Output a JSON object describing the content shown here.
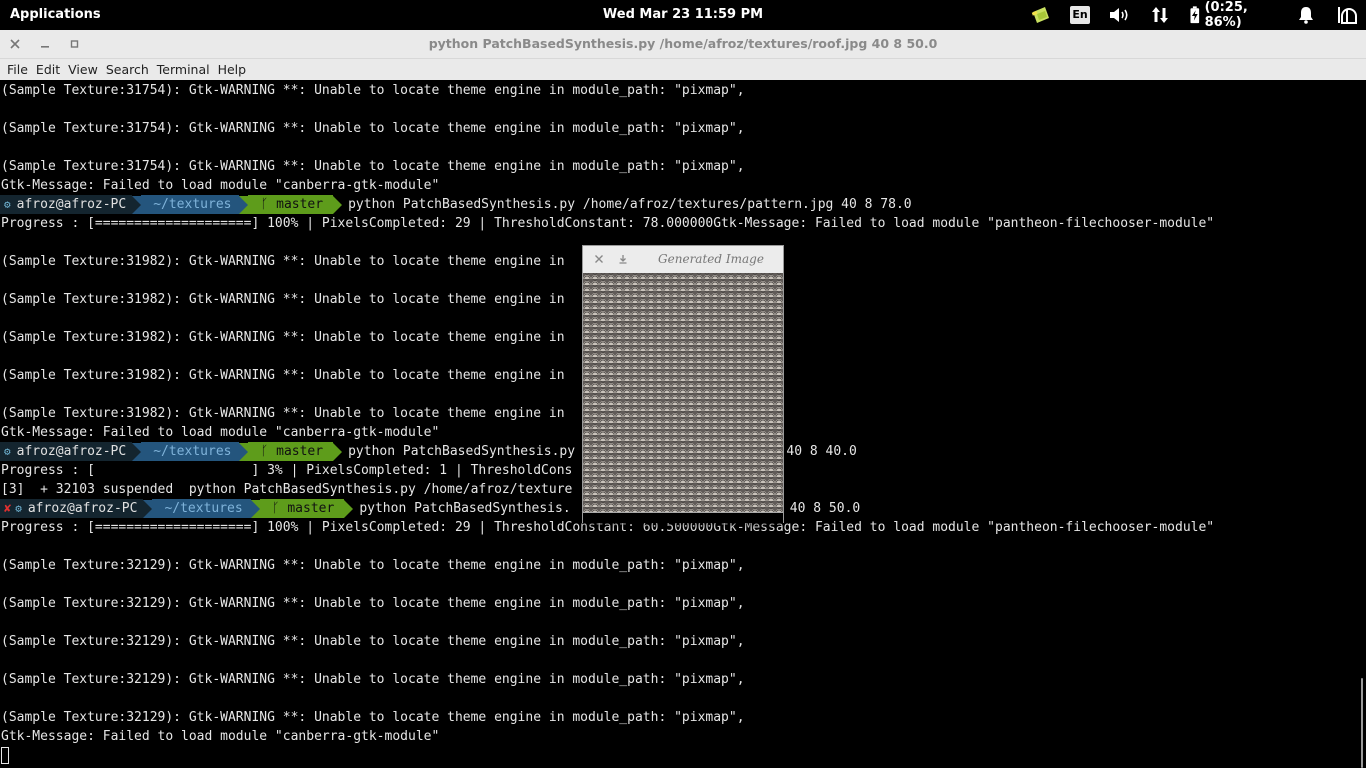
{
  "panel": {
    "applications_label": "Applications",
    "clock": "Wed Mar 23 11:59 PM",
    "lang_label": "En",
    "battery_label": "(0:25, 86%)"
  },
  "window": {
    "title": "python PatchBasedSynthesis.py /home/afroz/textures/roof.jpg 40 8 50.0",
    "menu": [
      "File",
      "Edit",
      "View",
      "Search",
      "Terminal",
      "Help"
    ]
  },
  "terminal": {
    "lines": [
      "(Sample Texture:31754): Gtk-WARNING **: Unable to locate theme engine in module_path: \"pixmap\",",
      "",
      "(Sample Texture:31754): Gtk-WARNING **: Unable to locate theme engine in module_path: \"pixmap\",",
      "",
      "(Sample Texture:31754): Gtk-WARNING **: Unable to locate theme engine in module_path: \"pixmap\",",
      "Gtk-Message: Failed to load module \"canberra-gtk-module\"",
      null,
      "Progress : [====================] 100% | PixelsCompleted: 29 | ThresholdConstant: 78.000000Gtk-Message: Failed to load module \"pantheon-filechooser-module\"",
      "",
      "(Sample Texture:31982): Gtk-WARNING **: Unable to locate theme engine in",
      "",
      "(Sample Texture:31982): Gtk-WARNING **: Unable to locate theme engine in",
      "",
      "(Sample Texture:31982): Gtk-WARNING **: Unable to locate theme engine in",
      "",
      "(Sample Texture:31982): Gtk-WARNING **: Unable to locate theme engine in",
      "",
      "(Sample Texture:31982): Gtk-WARNING **: Unable to locate theme engine in",
      "Gtk-Message: Failed to load module \"canberra-gtk-module\"",
      null,
      "Progress : [                    ] 3% | PixelsCompleted: 1 | ThresholdCons",
      "[3]  + 32103 suspended  python PatchBasedSynthesis.py /home/afroz/texture",
      null,
      "Progress : [====================] 100% | PixelsCompleted: 29 | ThresholdConstant: 60.500000Gtk-Message: Failed to load module \"pantheon-filechooser-module\"",
      "",
      "(Sample Texture:32129): Gtk-WARNING **: Unable to locate theme engine in module_path: \"pixmap\",",
      "",
      "(Sample Texture:32129): Gtk-WARNING **: Unable to locate theme engine in module_path: \"pixmap\",",
      "",
      "(Sample Texture:32129): Gtk-WARNING **: Unable to locate theme engine in module_path: \"pixmap\",",
      "",
      "(Sample Texture:32129): Gtk-WARNING **: Unable to locate theme engine in module_path: \"pixmap\",",
      "",
      "(Sample Texture:32129): Gtk-WARNING **: Unable to locate theme engine in module_path: \"pixmap\",",
      "Gtk-Message: Failed to load module \"canberra-gtk-module\""
    ],
    "prompts": [
      {
        "status": "ok",
        "user": "afroz@afroz-PC",
        "dir": "~/textures",
        "branch": "master",
        "command": "python PatchBasedSynthesis.py /home/afroz/textures/pattern.jpg 40 8 78.0"
      },
      {
        "status": "ok",
        "user": "afroz@afroz-PC",
        "dir": "~/textures",
        "branch": "master",
        "command": "python PatchBasedSynthesis.py                   oof.jpg 40 8 40.0"
      },
      {
        "status": "error",
        "user": "afroz@afroz-PC",
        "dir": "~/textures",
        "branch": "master",
        "command": "python PatchBasedSynthesis.                    oof.jpg 40 8 50.0"
      }
    ],
    "prompt_line_indices": [
      6,
      19,
      22
    ]
  },
  "generated_window": {
    "title": "Generated Image"
  },
  "colors": {
    "user_segment": "#14252f",
    "dir_segment": "#24557d",
    "git_segment": "#5e9c1b",
    "error_mark": "#e03030"
  }
}
